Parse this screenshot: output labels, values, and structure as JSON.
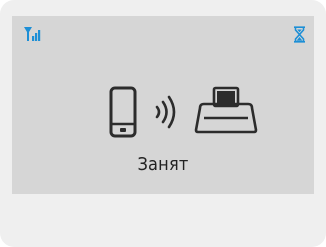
{
  "status": {
    "label": "Занят"
  },
  "icons": {
    "signal": "signal-strength-icon",
    "busy": "hourglass-icon",
    "device": "smartphone-icon",
    "transfer": "wireless-waves-icon",
    "target": "printer-icon"
  },
  "colors": {
    "screen_bg": "#d6d6d6",
    "frame_bg": "#efefef",
    "accent": "#1d8fd6",
    "icon": "#2c2c2c",
    "text": "#222222"
  }
}
